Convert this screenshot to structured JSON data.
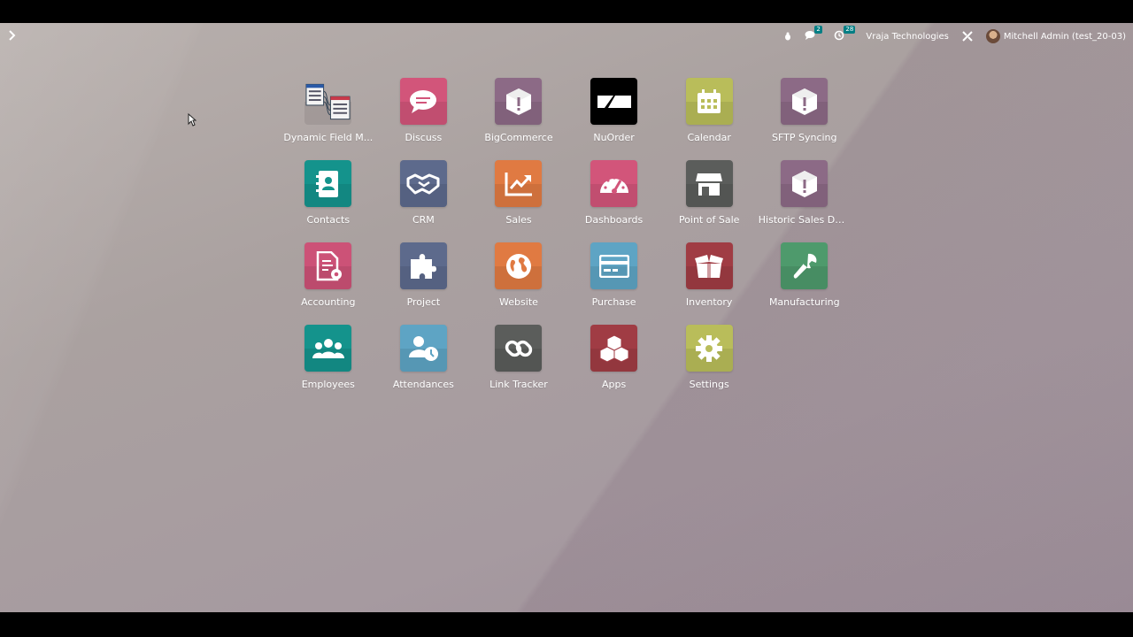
{
  "systray": {
    "messages_count": "2",
    "activities_count": "28",
    "company": "Vraja Technologies",
    "user": "Mitchell Admin (test_20-03)"
  },
  "apps": [
    {
      "label": "Dynamic Field M...",
      "icon": "dynamic-field-icon",
      "color": "none"
    },
    {
      "label": "Discuss",
      "icon": "chat-bubble-icon",
      "color": "#d2557a"
    },
    {
      "label": "BigCommerce",
      "icon": "package-alert-icon",
      "color": "#8c6a86"
    },
    {
      "label": "NuOrder",
      "icon": "nuorder-logo-icon",
      "color": "#000000"
    },
    {
      "label": "Calendar",
      "icon": "calendar-icon",
      "color": "#b9bd5a"
    },
    {
      "label": "SFTP Syncing",
      "icon": "package-alert-icon",
      "color": "#8c6a86"
    },
    {
      "label": "Contacts",
      "icon": "address-book-icon",
      "color": "#14938c"
    },
    {
      "label": "CRM",
      "icon": "handshake-icon",
      "color": "#5d6a8c"
    },
    {
      "label": "Sales",
      "icon": "trend-chart-icon",
      "color": "#e07a42"
    },
    {
      "label": "Dashboards",
      "icon": "gauge-icon",
      "color": "#d2557a"
    },
    {
      "label": "Point of Sale",
      "icon": "storefront-icon",
      "color": "#5b5d5b"
    },
    {
      "label": "Historic Sales Data",
      "icon": "package-alert-icon",
      "color": "#8c6a86"
    },
    {
      "label": "Accounting",
      "icon": "invoice-gear-icon",
      "color": "#cc5277"
    },
    {
      "label": "Project",
      "icon": "puzzle-icon",
      "color": "#5d6a8c"
    },
    {
      "label": "Website",
      "icon": "globe-icon",
      "color": "#e07a42"
    },
    {
      "label": "Purchase",
      "icon": "credit-card-icon",
      "color": "#5ea4c4"
    },
    {
      "label": "Inventory",
      "icon": "open-box-icon",
      "color": "#a03c44"
    },
    {
      "label": "Manufacturing",
      "icon": "wrench-icon",
      "color": "#4e9a6c"
    },
    {
      "label": "Employees",
      "icon": "people-icon",
      "color": "#14938c"
    },
    {
      "label": "Attendances",
      "icon": "user-clock-icon",
      "color": "#5ea4c4"
    },
    {
      "label": "Link Tracker",
      "icon": "link-icon",
      "color": "#5b5d5b"
    },
    {
      "label": "Apps",
      "icon": "cubes-icon",
      "color": "#a03c44"
    },
    {
      "label": "Settings",
      "icon": "gear-icon",
      "color": "#b9bd5a"
    }
  ]
}
